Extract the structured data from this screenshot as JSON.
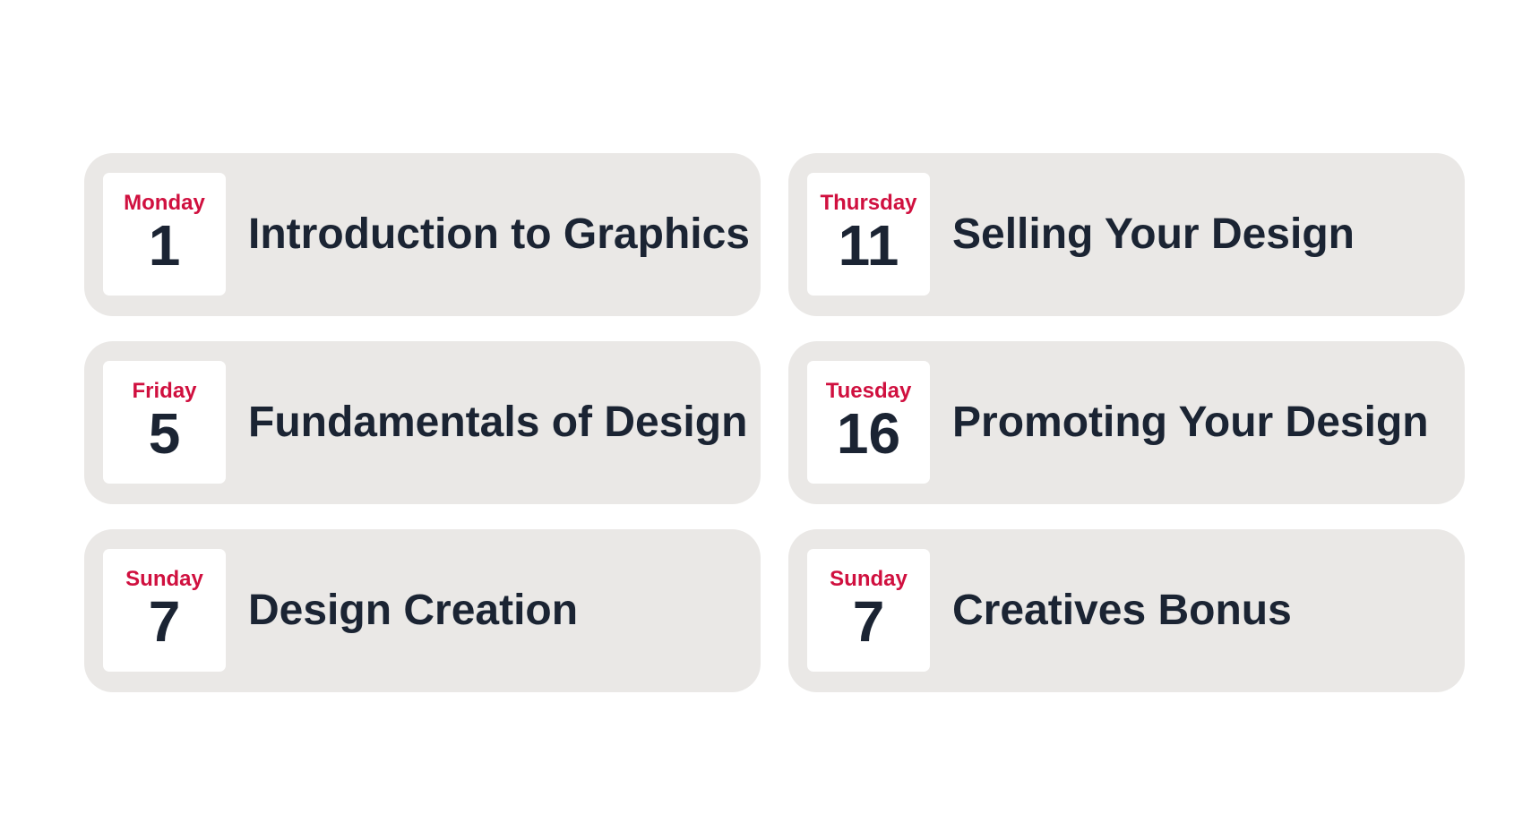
{
  "colors": {
    "background": "#ffffff",
    "card": "#eae8e6",
    "date_box": "#ffffff",
    "weekday": "#d0103f",
    "text": "#1b2433"
  },
  "sessions": [
    {
      "weekday": "Monday",
      "day": "1",
      "title": "Introduction to Graphics"
    },
    {
      "weekday": "Thursday",
      "day": "11",
      "title": "Selling Your Design"
    },
    {
      "weekday": "Friday",
      "day": "5",
      "title": "Fundamentals of Design"
    },
    {
      "weekday": "Tuesday",
      "day": "16",
      "title": "Promoting Your Design"
    },
    {
      "weekday": "Sunday",
      "day": "7",
      "title": "Design Creation"
    },
    {
      "weekday": "Sunday",
      "day": "7",
      "title": "Creatives Bonus"
    }
  ]
}
